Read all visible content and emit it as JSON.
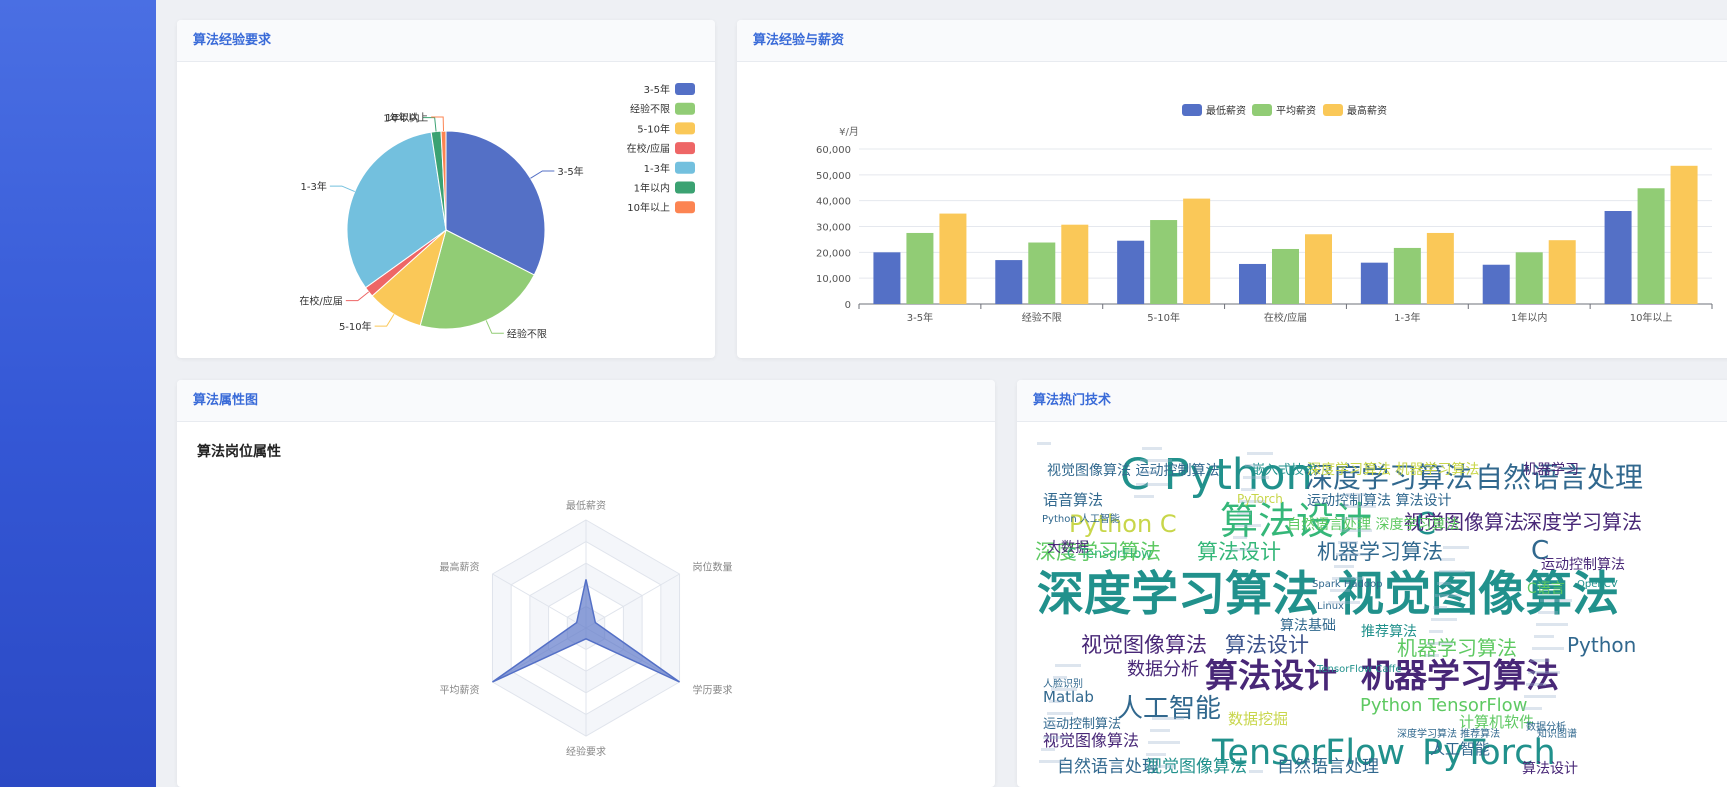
{
  "cards": {
    "pie": {
      "title": "算法经验要求"
    },
    "bar": {
      "title": "算法经验与薪资"
    },
    "radar": {
      "title": "算法属性图"
    },
    "cloud": {
      "title": "算法热门技术"
    }
  },
  "colors": {
    "blue": "#5470c6",
    "green": "#91cc75",
    "yellow": "#fac858",
    "red": "#ee6666",
    "cyan": "#73c0de",
    "teal": "#3ba272",
    "orange": "#fc8452",
    "header_text": "#3a6bd8"
  },
  "chart_data": [
    {
      "type": "pie",
      "slices": [
        {
          "name": "3-5年",
          "value": 32.5
        },
        {
          "name": "经验不限",
          "value": 21.7
        },
        {
          "name": "5-10年",
          "value": 9.2
        },
        {
          "name": "在校/应届",
          "value": 1.7
        },
        {
          "name": "1-3年",
          "value": 32.5
        },
        {
          "name": "1年以内",
          "value": 1.6
        },
        {
          "name": "10年以上",
          "value": 0.8
        }
      ],
      "legend": [
        "3-5年",
        "经验不限",
        "5-10年",
        "在校/应届",
        "1-3年",
        "1年以内",
        "10年以上"
      ],
      "legend_position": "right"
    },
    {
      "type": "bar",
      "categories": [
        "3-5年",
        "经验不限",
        "5-10年",
        "在校/应届",
        "1-3年",
        "1年以内",
        "10年以上"
      ],
      "series": [
        {
          "name": "最低薪资",
          "values": [
            20000,
            17000,
            24500,
            15500,
            16000,
            15200,
            36000
          ]
        },
        {
          "name": "平均薪资",
          "values": [
            27500,
            23800,
            32500,
            21300,
            21700,
            20000,
            44800
          ]
        },
        {
          "name": "最高薪资",
          "values": [
            35000,
            30700,
            40800,
            27000,
            27500,
            24700,
            53500
          ]
        }
      ],
      "ylabel": "¥/月",
      "yticks": [
        "0",
        "10,000",
        "20,000",
        "30,000",
        "40,000",
        "50,000",
        "60,000"
      ],
      "ylim": [
        0,
        60000
      ],
      "legend_position": "top"
    },
    {
      "type": "radar",
      "title": "算法岗位属性",
      "indicators": [
        "最低薪资",
        "岗位数量",
        "学历要求",
        "经验要求",
        "平均薪资",
        "最高薪资"
      ],
      "values": [
        0.45,
        0.1,
        1.0,
        0.1,
        1.0,
        0.1
      ]
    }
  ],
  "wordcloud": [
    {
      "text": "深度学习算法",
      "c": "#21918c",
      "w": "bold"
    },
    {
      "text": "视觉图像算法",
      "c": "#21918c",
      "w": "bold"
    },
    {
      "text": "C Python",
      "c": "#21918c"
    },
    {
      "text": "深度学习算法",
      "c": "#31688e"
    },
    {
      "text": "自然语言处理",
      "c": "#31688e"
    },
    {
      "text": "算法设计",
      "c": "#35b779"
    },
    {
      "text": "C",
      "c": "#21918c"
    },
    {
      "text": "Python C",
      "c": "#c8d64a"
    },
    {
      "text": "视觉图像算法",
      "c": "#482777"
    },
    {
      "text": "深度学习算法",
      "c": "#482777"
    },
    {
      "text": "深度学习算法",
      "c": "#5ec962"
    },
    {
      "text": "算法设计",
      "c": "#35b779"
    },
    {
      "text": "机器学习算法",
      "c": "#31688e"
    },
    {
      "text": "C",
      "c": "#31688e"
    },
    {
      "text": "视觉图像算法",
      "c": "#482777"
    },
    {
      "text": "算法设计",
      "c": "#3b528b"
    },
    {
      "text": "机器学习算法",
      "c": "#5ec962"
    },
    {
      "text": "Python",
      "c": "#31688e"
    },
    {
      "text": "数据分析",
      "c": "#482777"
    },
    {
      "text": "算法设计",
      "c": "#482777",
      "w": "bold"
    },
    {
      "text": "机器学习算法",
      "c": "#482777",
      "w": "bold"
    },
    {
      "text": "人工智能",
      "c": "#31688e"
    },
    {
      "text": "Python TensorFlow",
      "c": "#5ec962"
    },
    {
      "text": "TensorFlow",
      "c": "#21918c"
    },
    {
      "text": "PyTorch",
      "c": "#21918c"
    },
    {
      "text": "视觉图像算法",
      "c": "#482777"
    },
    {
      "text": "自然语言处理",
      "c": "#31688e"
    },
    {
      "text": "视觉图像算法",
      "c": "#21918c"
    },
    {
      "text": "自然语言处理",
      "c": "#31688e"
    },
    {
      "text": "算法设计",
      "c": "#482777"
    },
    {
      "text": "语音算法",
      "c": "#31688e"
    },
    {
      "text": "大数据",
      "c": "#482777"
    },
    {
      "text": "Matlab",
      "c": "#31688e"
    },
    {
      "text": "数据挖掘",
      "c": "#c8d64a"
    },
    {
      "text": "计算机软件",
      "c": "#5ec962"
    },
    {
      "text": "运动控制算法",
      "c": "#31688e"
    },
    {
      "text": "嵌入式技术",
      "c": "#21918c"
    },
    {
      "text": "机器学习",
      "c": "#482777"
    },
    {
      "text": "C TensorFlow",
      "c": "#35b779"
    },
    {
      "text": "运动控制算法",
      "c": "#482777"
    },
    {
      "text": "C语言",
      "c": "#5ec962"
    },
    {
      "text": "推荐算法",
      "c": "#21918c"
    },
    {
      "text": "算法基础",
      "c": "#31688e"
    },
    {
      "text": "视觉图像算法 运动控制算法",
      "c": "#31688e"
    },
    {
      "text": "深度学习算法 机器学习算法",
      "c": "#c8d64a"
    },
    {
      "text": "自然语言处理 深度学习算法",
      "c": "#5ec962"
    },
    {
      "text": "运动控制算法 算法设计",
      "c": "#31688e"
    },
    {
      "text": "人工智能",
      "c": "#31688e"
    },
    {
      "text": "PyTorch",
      "c": "#c8d64a"
    },
    {
      "text": "Python 人工智能",
      "c": "#31688e"
    },
    {
      "text": "TensorFlow Caffe",
      "c": "#21918c"
    },
    {
      "text": "Spark Hadoop",
      "c": "#31688e"
    },
    {
      "text": "知识图谱",
      "c": "#31688e"
    },
    {
      "text": "数据分析",
      "c": "#31688e"
    },
    {
      "text": "人脸识别",
      "c": "#31688e"
    },
    {
      "text": "深度学习算法 推荐算法",
      "c": "#31688e"
    },
    {
      "text": "OpenCV",
      "c": "#21918c"
    },
    {
      "text": "Linux",
      "c": "#31688e"
    }
  ]
}
